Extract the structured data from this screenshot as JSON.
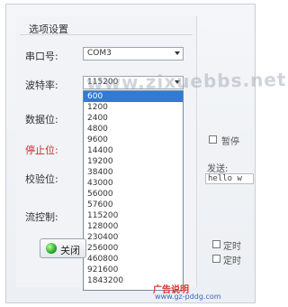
{
  "group_title": "选项设置",
  "fields": {
    "port_label": "串口号:",
    "port_value": "COM3",
    "baud_label": "波特率:",
    "baud_value": "115200",
    "data_bits_label": "数据位:",
    "stop_bits_label": "停止位:",
    "parity_label": "校验位:",
    "flow_label": "流控制:"
  },
  "baud_options": [
    "600",
    "1200",
    "2400",
    "4800",
    "9600",
    "14400",
    "19200",
    "38400",
    "43000",
    "56000",
    "57600",
    "115200",
    "128000",
    "230400",
    "256000",
    "460800",
    "921600",
    "1843200"
  ],
  "selected_baud_option": "600",
  "right_panel": {
    "pause_label": "暂停",
    "send_label": "发送:",
    "send_text": "hello w",
    "timer_label_1": "定时",
    "timer_label_2": "定时"
  },
  "close_button": "关闭",
  "watermark": "www.zixuebbs.net",
  "brand_text": "广告说明",
  "brand_url": "www.gz-pddg.com"
}
